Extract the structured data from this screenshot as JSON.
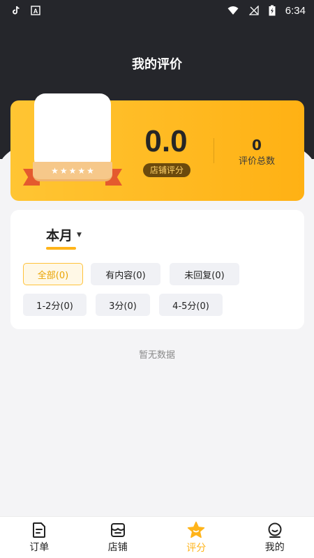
{
  "status_bar": {
    "time": "6:34",
    "left_icons": [
      "tiktok-icon",
      "a-app-icon"
    ],
    "right_icons": [
      "wifi-icon",
      "no-signal-icon",
      "battery-charging-icon"
    ]
  },
  "header": {
    "title": "我的评价",
    "background": "#25262b"
  },
  "score_card": {
    "score": "0.0",
    "score_label": "店铺评分",
    "total_count": "0",
    "total_label": "评价总数",
    "stars": 5,
    "accent": "#ffb41a"
  },
  "filters": {
    "period": "本月",
    "chips": [
      {
        "label": "全部(0)",
        "active": true
      },
      {
        "label": "有内容(0)",
        "active": false
      },
      {
        "label": "未回复(0)",
        "active": false
      },
      {
        "label": "1-2分(0)",
        "active": false
      },
      {
        "label": "3分(0)",
        "active": false
      },
      {
        "label": "4-5分(0)",
        "active": false
      }
    ]
  },
  "empty_state": "暂无数据",
  "bottom_nav": [
    {
      "label": "订单",
      "icon": "orders-icon",
      "active": false
    },
    {
      "label": "店铺",
      "icon": "shop-icon",
      "active": false
    },
    {
      "label": "评分",
      "icon": "rating-star-icon",
      "active": true
    },
    {
      "label": "我的",
      "icon": "profile-icon",
      "active": false
    }
  ]
}
